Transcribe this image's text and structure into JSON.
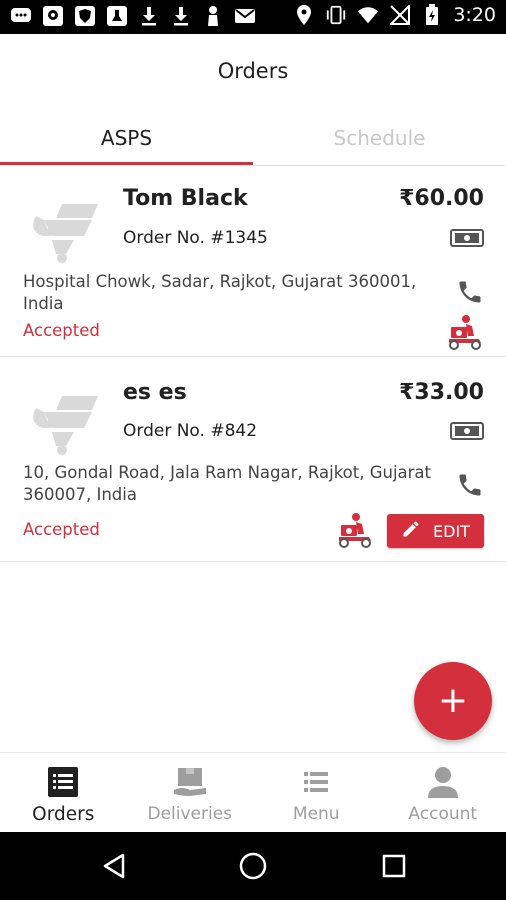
{
  "status_bar": {
    "time": "3:20",
    "left_icons": [
      "chat-icon",
      "location-app-icon",
      "shield-app-icon",
      "tag-app-icon",
      "download-icon",
      "download-icon",
      "person-icon",
      "mail-icon"
    ],
    "right_icons": [
      "location-pin-icon",
      "vibrate-icon",
      "wifi-icon",
      "signal-icon",
      "battery-icon"
    ]
  },
  "app_bar": {
    "title": "Orders"
  },
  "tabs": [
    {
      "label": "ASPS",
      "active": true
    },
    {
      "label": "Schedule",
      "active": false
    }
  ],
  "orders": [
    {
      "customer": "Tom Black",
      "order_no": "Order No. #1345",
      "amount": "₹60.00",
      "address": "Hospital Chowk, Sadar, Rajkot, Gujarat 360001, India",
      "status": "Accepted",
      "has_edit": false
    },
    {
      "customer": "es es",
      "order_no": "Order No. #842",
      "amount": "₹33.00",
      "address": "10, Gondal Road, Jala Ram Nagar, Rajkot, Gujarat 360007, India",
      "status": "Accepted",
      "has_edit": true,
      "edit_label": "EDIT"
    }
  ],
  "fab": {
    "label": "+"
  },
  "bottom_nav": [
    {
      "label": "Orders",
      "icon": "orders-list-icon",
      "active": true
    },
    {
      "label": "Deliveries",
      "icon": "delivery-box-icon",
      "active": false
    },
    {
      "label": "Menu",
      "icon": "menu-list-icon",
      "active": false
    },
    {
      "label": "Account",
      "icon": "account-icon",
      "active": false
    }
  ],
  "colors": {
    "accent": "#d32f3c",
    "status_accepted": "#d32f3c",
    "inactive": "#9e9e9e"
  }
}
